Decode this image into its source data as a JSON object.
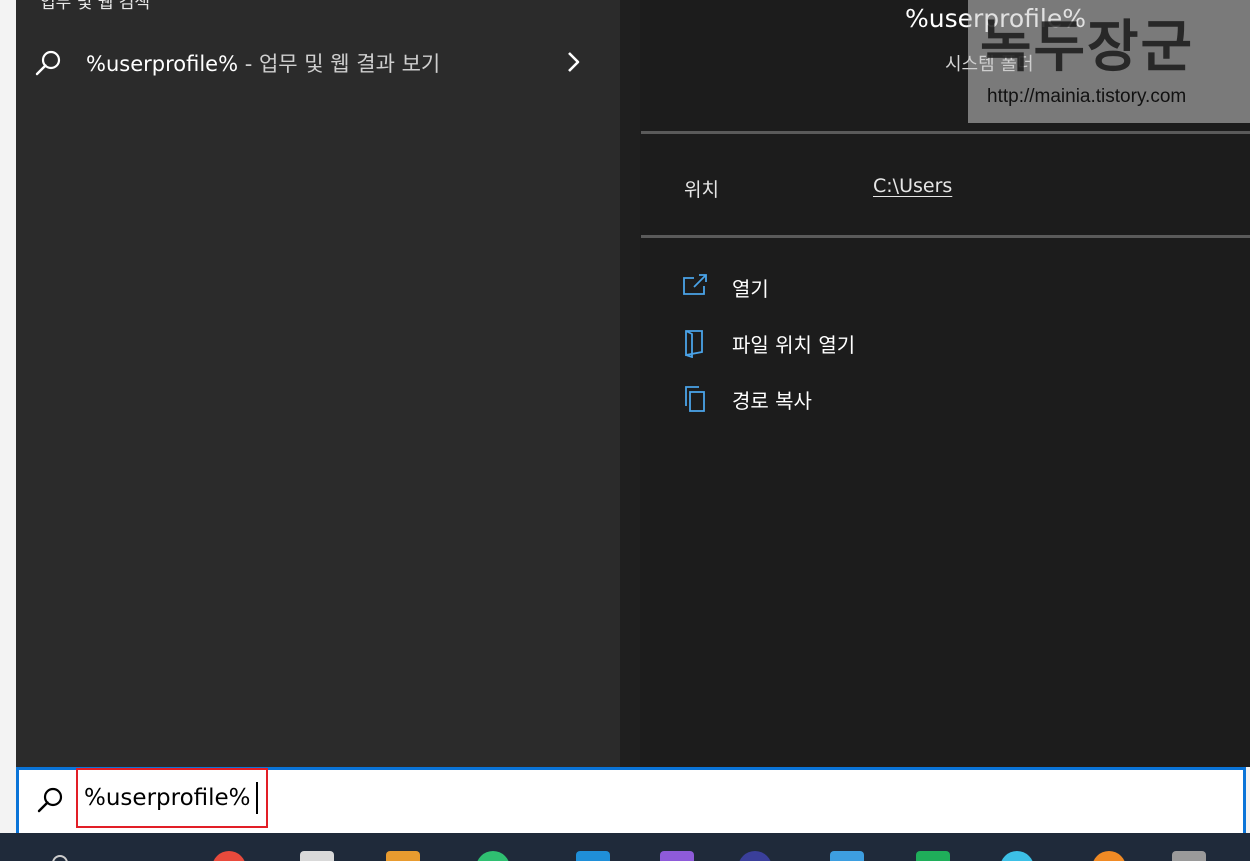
{
  "left": {
    "section_title": "업무 및 웹 검색",
    "result": {
      "query": "%userprofile%",
      "suffix": " - 업무 및 웹 결과 보기"
    }
  },
  "right": {
    "title": "%userprofile%",
    "subtitle": "시스템 폴더",
    "location_label": "위치",
    "location_value": "C:\\Users",
    "actions": [
      {
        "label": "열기",
        "icon": "open-external-icon"
      },
      {
        "label": "파일 위치 열기",
        "icon": "folder-location-icon"
      },
      {
        "label": "경로 복사",
        "icon": "copy-icon"
      }
    ]
  },
  "watermark": {
    "brand": "녹두장군",
    "url": "http://mainia.tistory.com"
  },
  "search": {
    "value": "%userprofile%"
  },
  "colors": {
    "accent": "#0a74d8",
    "highlight": "#e21e26",
    "icon_blue": "#4aa3e8"
  }
}
